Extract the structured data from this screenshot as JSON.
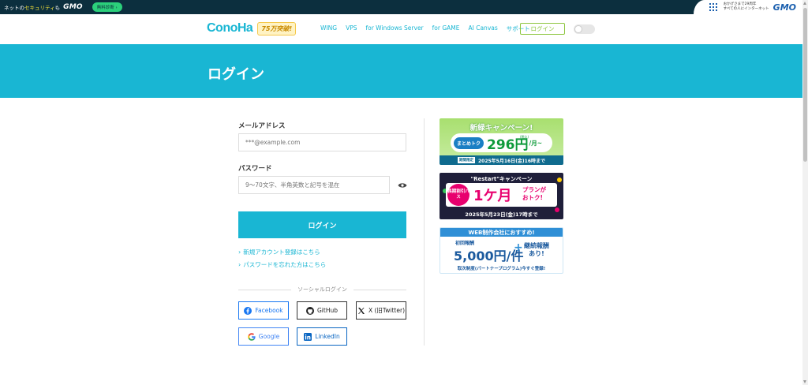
{
  "gmo_bar": {
    "security_text_prefix": "ネットの",
    "security_text_highlight": "セキュリティ",
    "security_text_suffix": "も",
    "gmo_logo": "GMO",
    "free_badge": "無料診断 ›",
    "right_text_line1": "おかげさまで29周年",
    "right_text_line2": "すべての人にインターネット",
    "right_logo": "GMO"
  },
  "header": {
    "brand_logo": "ConoHa",
    "brand_badge": "75万突破!",
    "nav": [
      "WING",
      "VPS",
      "for Windows Server",
      "for GAME",
      "AI Canvas",
      "サポート"
    ],
    "login_button": "ログイン"
  },
  "hero": {
    "title": "ログイン"
  },
  "form": {
    "email_label": "メールアドレス",
    "email_placeholder": "***@example.com",
    "password_label": "パスワード",
    "password_placeholder": "9〜70文字、半角英数と記号を混在",
    "submit_label": "ログイン",
    "signup_link": "新規アカウント登録はこちら",
    "forgot_link": "パスワードを忘れた方はこちら",
    "social_heading": "ソーシャルログイン",
    "social": {
      "facebook": "Facebook",
      "github": "GitHub",
      "x": "X (旧Twitter)",
      "google": "Google",
      "linkedin": "LinkedIn"
    }
  },
  "banners": {
    "b1": {
      "title": "新緑キャンペーン!",
      "tag": "まとめトク",
      "price": "296円",
      "unit": "/月~",
      "tax": "(税込)",
      "footer_tag": "期間限定",
      "footer": "2025年5月16日(金)16時まで"
    },
    "b2": {
      "title": "\"Restart\"キャンペーン",
      "circle": "長期割引パス",
      "big": "1ケ月",
      "plan_line1": "プランが",
      "plan_line2": "おトク!",
      "footer": "2025年5月23日(金)17時まで"
    },
    "b3": {
      "title": "WEB制作会社におすすめ!",
      "small": "初回報酬",
      "big": "5,000円/件",
      "plus": "+",
      "cont_line1": "継続報酬",
      "cont_line2": "あり!",
      "footer": "取次制度(パートナープログラム)今すぐ登録!"
    }
  },
  "colors": {
    "accent": "#19b6d3",
    "gmo_bar": "#0c2f3e",
    "header_login": "#8dc63f"
  }
}
